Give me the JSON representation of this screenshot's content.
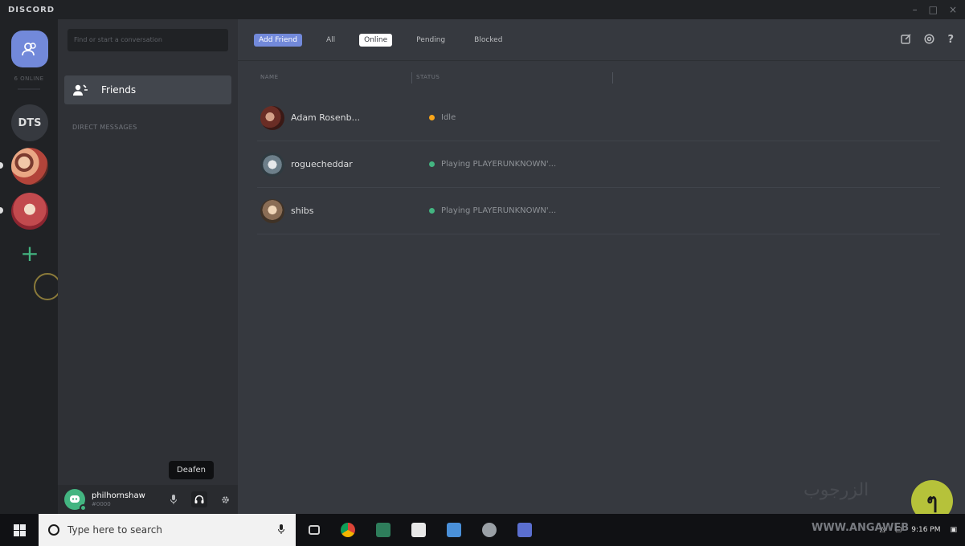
{
  "window": {
    "title": "DISCORD",
    "controls": [
      "–",
      "□",
      "×"
    ]
  },
  "servers": {
    "home_icon": "friends-icon",
    "online_label": "6 ONLINE",
    "items": [
      {
        "label": "DTS"
      }
    ],
    "add_label": "+"
  },
  "sidebar": {
    "search_placeholder": "Find or start a conversation",
    "friends_label": "Friends",
    "dm_header": "DIRECT MESSAGES",
    "user": {
      "name": "philhornshaw",
      "discriminator": "#0000"
    },
    "tooltip": "Deafen"
  },
  "topbar": {
    "tabs": [
      {
        "label": "Add Friend"
      },
      {
        "label": "All"
      },
      {
        "label": "Online"
      },
      {
        "label": "Pending"
      },
      {
        "label": "Blocked"
      }
    ]
  },
  "friends": {
    "columns": {
      "name": "NAME",
      "status": "STATUS"
    },
    "rows": [
      {
        "name": "Adam Rosenb...",
        "status": "Idle",
        "status_color": "#faa61a"
      },
      {
        "name": "roguecheddar",
        "status": "Playing PLAYERUNKNOWN'...",
        "status_color": "#43b581"
      },
      {
        "name": "shibs",
        "status": "Playing PLAYERUNKNOWN'...",
        "status_color": "#43b581"
      }
    ]
  },
  "taskbar": {
    "search_placeholder": "Type here to search",
    "time": "9:16 PM"
  },
  "watermark": {
    "arabic": "الزرجوب",
    "url": "WWW.ANGAWEB"
  },
  "colors": {
    "accent": "#7289da",
    "online": "#43b581",
    "idle": "#faa61a",
    "background": "#36393f"
  }
}
